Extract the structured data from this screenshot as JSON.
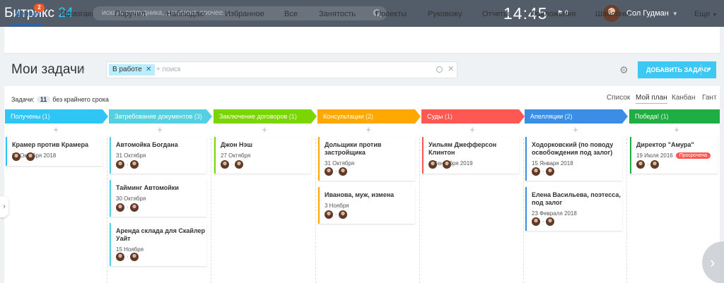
{
  "header": {
    "logo_text": "Битрикс",
    "logo_num": "24",
    "search_placeholder": "искать сотрудника, документ, прочее...",
    "clock": "14:45",
    "flag_count": "0",
    "user_name": "Сол Гудман"
  },
  "tabs": [
    {
      "label": "Делаю",
      "badge": "2"
    },
    {
      "label": "Помогаю"
    },
    {
      "label": "Поручил"
    },
    {
      "label": "Наблюдаю"
    },
    {
      "label": "Избранное"
    },
    {
      "label": "Все"
    },
    {
      "label": "Занятость"
    },
    {
      "label": "Проекты"
    },
    {
      "label": "Руковожу"
    },
    {
      "label": "Отчеты"
    },
    {
      "label": "Приложения"
    },
    {
      "label": "Шаблоны"
    },
    {
      "label": "Еще"
    }
  ],
  "page": {
    "title": "Мои задачи",
    "filter_chip": "В работе",
    "filter_placeholder": "+ поиск",
    "add_button": "ДОБАВИТЬ ЗАДАЧУ",
    "info_prefix": "Задачи:",
    "info_count": "11",
    "info_suffix": "без крайнего срока"
  },
  "views": [
    "Список",
    "Мой план",
    "Канбан",
    "Гант"
  ],
  "columns": [
    {
      "title": "Получены",
      "count": "(1)",
      "color": "#2fc6f6",
      "cards": [
        {
          "title": "Крамер против Крамера",
          "date": "26 Октября 2018"
        }
      ]
    },
    {
      "title": "Затребование документов",
      "count": "(3)",
      "color": "#55d0e0",
      "cards": [
        {
          "title": "Автомойка Богдана",
          "date": "31 Октября"
        },
        {
          "title": "Тайминг Автомойки",
          "date": "30 Октября"
        },
        {
          "title": "Аренда склада для Скайлер Уайт",
          "date": "15 Ноября"
        }
      ]
    },
    {
      "title": "Заключение договоров",
      "count": "(1)",
      "color": "#7bd500",
      "cards": [
        {
          "title": "Джон Нэш",
          "date": "27 Октября"
        }
      ]
    },
    {
      "title": "Консультации",
      "count": "(2)",
      "color": "#ffa900",
      "cards": [
        {
          "title": "Дольщики против застройщика",
          "date": "31 Октября"
        },
        {
          "title": "Иванова, муж, измена",
          "date": "3 Ноября"
        }
      ]
    },
    {
      "title": "Суды",
      "count": "(1)",
      "color": "#ff5752",
      "cards": [
        {
          "title": "Уильям Джефферсон Клинтон",
          "date": "4 Сентября 2019"
        }
      ]
    },
    {
      "title": "Апелляции",
      "count": "(2)",
      "color": "#3a8ee6",
      "cards": [
        {
          "title": "Ходорковский (по поводу освобождения под залог)",
          "date": "15 Января 2018"
        },
        {
          "title": "Елена Васильева, поэтесса, под залог",
          "date": "23 Февраля 2018"
        }
      ]
    },
    {
      "title": "Победа!",
      "count": "(1)",
      "color": "#1eae43",
      "cards": [
        {
          "title": "Директор \"Амура\"",
          "date": "19 Июля 2016",
          "badge": "Просрочена"
        }
      ]
    }
  ]
}
